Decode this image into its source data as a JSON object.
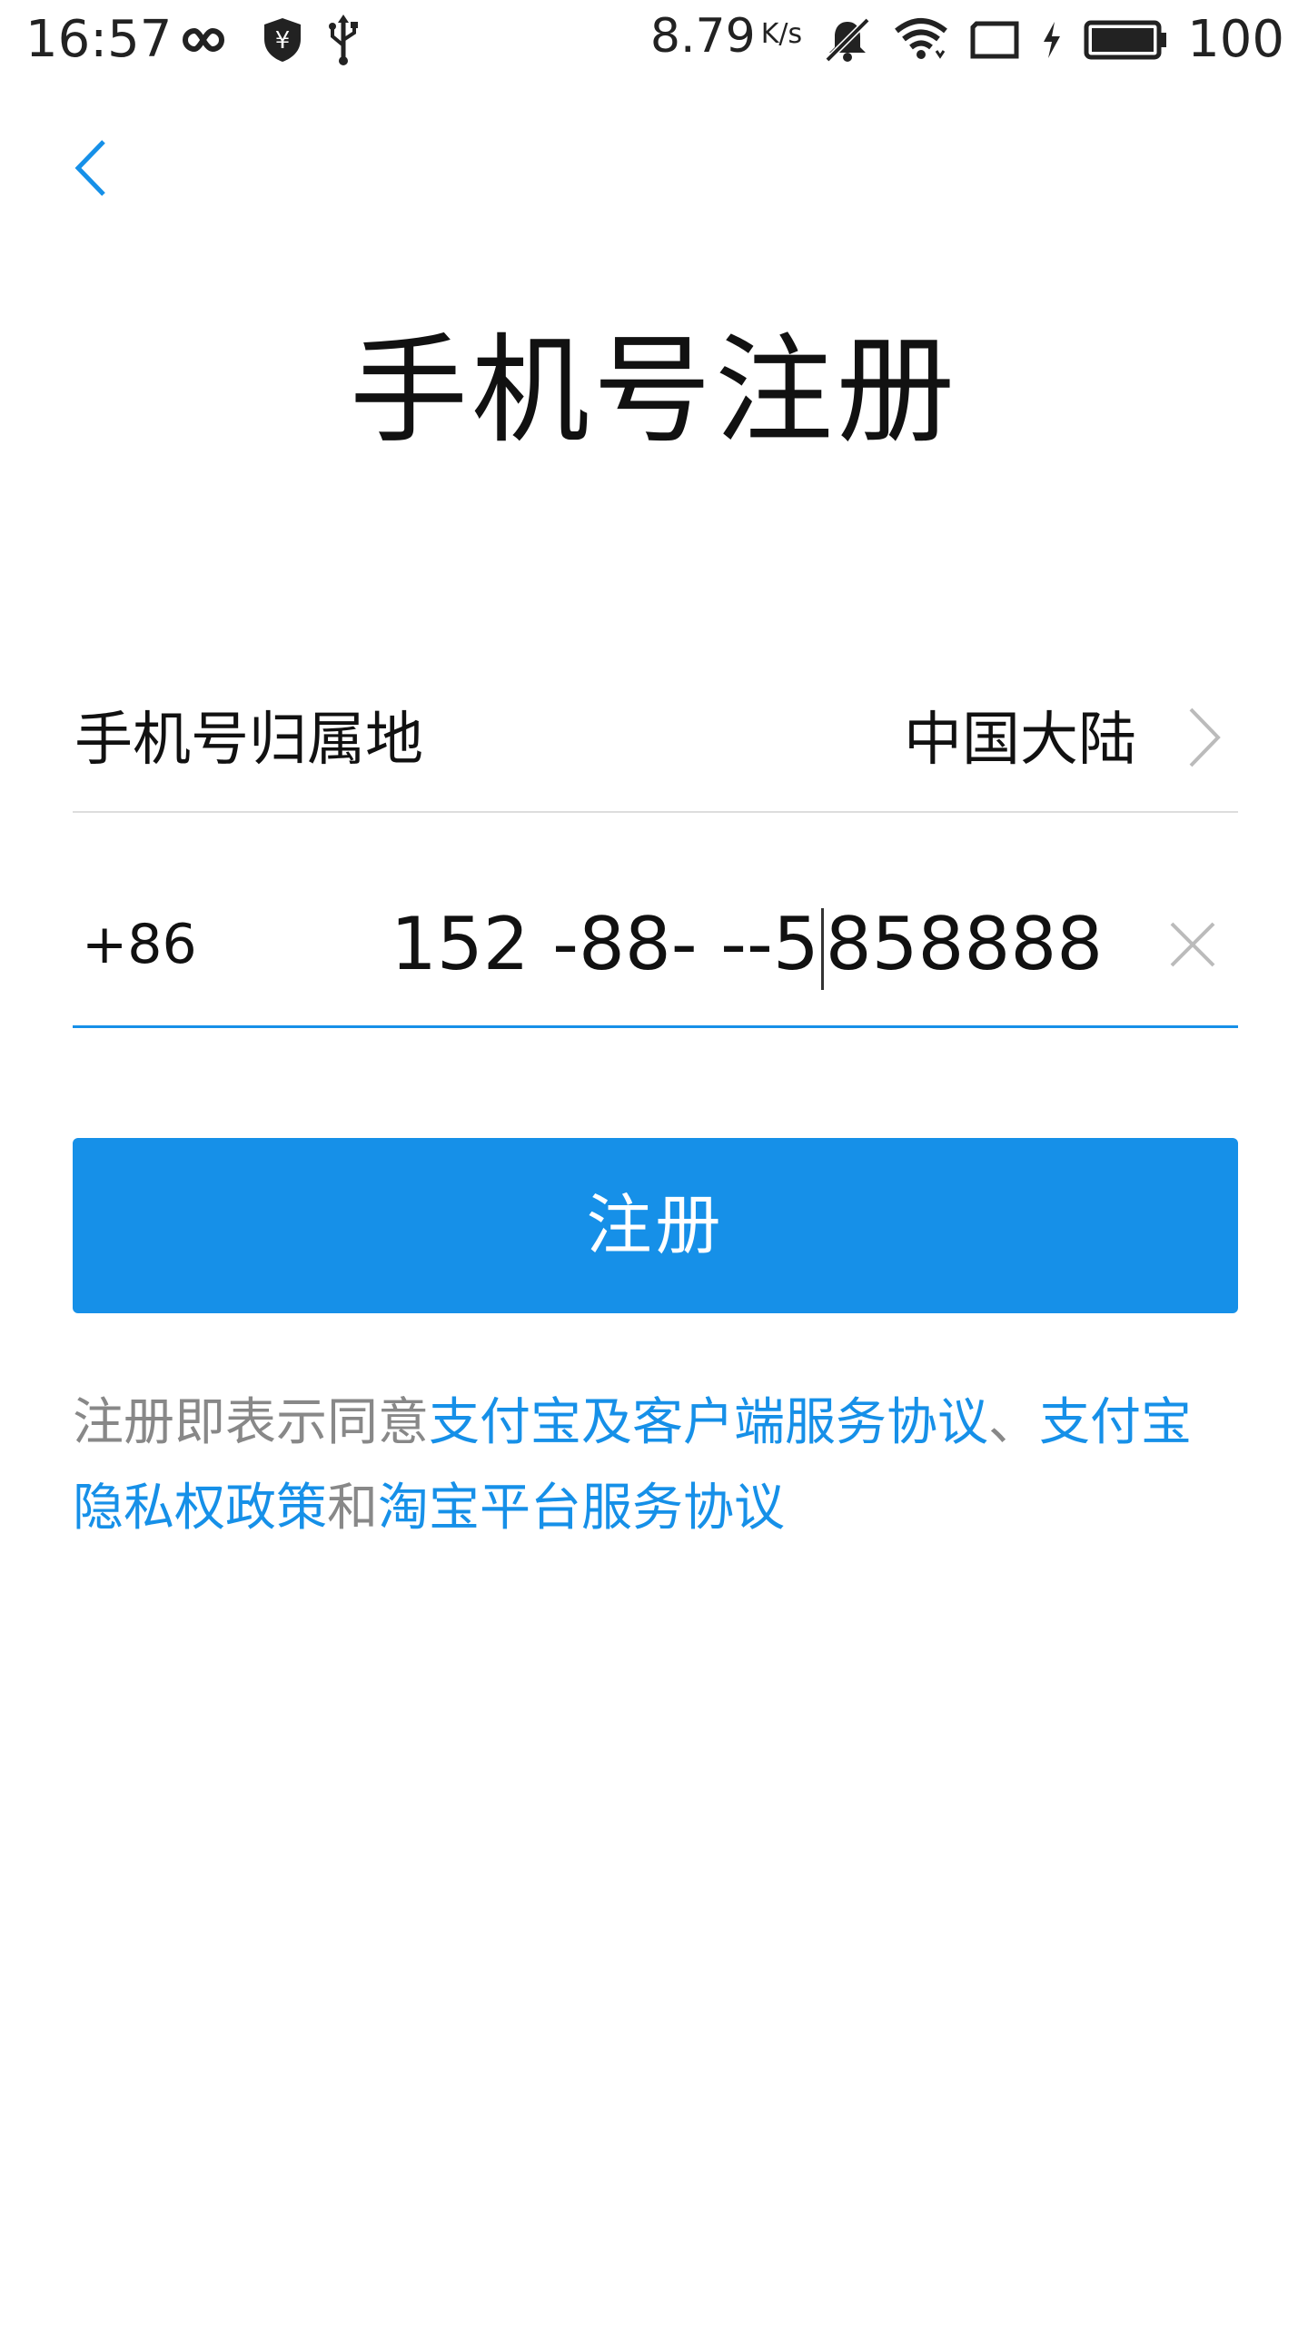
{
  "status_bar": {
    "time": "16:57",
    "left_icons": [
      "infinity-icon",
      "shield-yen-icon",
      "usb-icon"
    ],
    "network_speed": "8.79",
    "network_speed_unit": "K/s",
    "right_icons": [
      "bell-muted-icon",
      "wifi-icon",
      "screen-icon",
      "charging-icon",
      "battery-icon"
    ],
    "battery_percent": "100"
  },
  "header": {
    "back_icon": "chevron-left-icon"
  },
  "title": "手机号注册",
  "region": {
    "label": "手机号归属地",
    "value": "中国大陆",
    "chevron_icon": "chevron-right-icon"
  },
  "phone": {
    "prefix": "+86",
    "value_before_cursor": "152 -88- --5",
    "value_after_cursor": "858888",
    "clear_icon": "close-icon"
  },
  "register_button": {
    "label": "注册"
  },
  "agreement": {
    "prefix": "注册即表示同意",
    "link1": "支付宝及客户端服务协议",
    "sep": "、",
    "link2": "支付宝隐私权政策",
    "and": "和",
    "link3": "淘宝平台服务协议"
  },
  "colors": {
    "accent": "#1690e8",
    "text": "#111111",
    "muted": "#888888",
    "divider": "#dddddd"
  }
}
